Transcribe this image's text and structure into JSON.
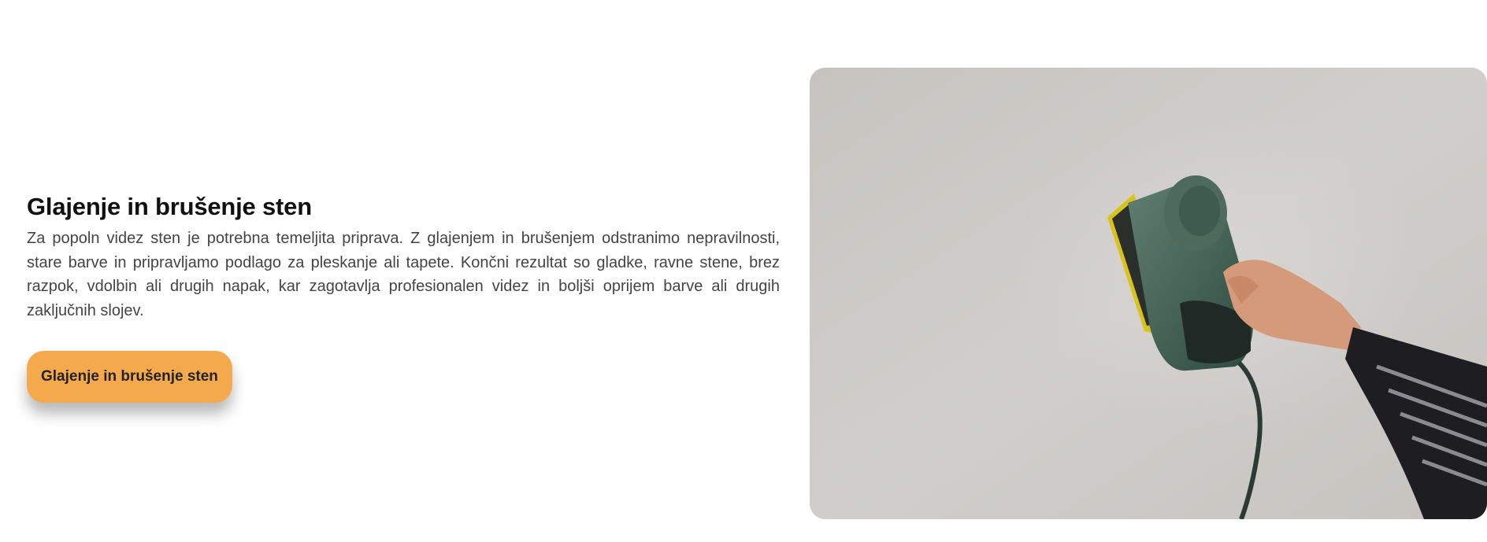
{
  "section": {
    "title": "Glajenje in brušenje sten",
    "description": "Za popoln videz sten je potrebna temeljita priprava. Z glajenjem in brušenjem odstranimo nepravilnosti, stare barve in pripravljamo podlago za pleskanje ali tapete. Končni rezultat so gladke, ravne stene, brez razpok, vdolbin ali drugih napak, kar zagotavlja profesionalen videz in boljši oprijem barve ali drugih zaključnih slojev.",
    "button_label": "Glajenje in brušenje sten"
  },
  "colors": {
    "accent": "#f4a94d",
    "title": "#111111",
    "body": "#444444",
    "wall": "#c9c6c2"
  },
  "image": {
    "subject": "hand-holding-orbital-sander-on-wall"
  }
}
